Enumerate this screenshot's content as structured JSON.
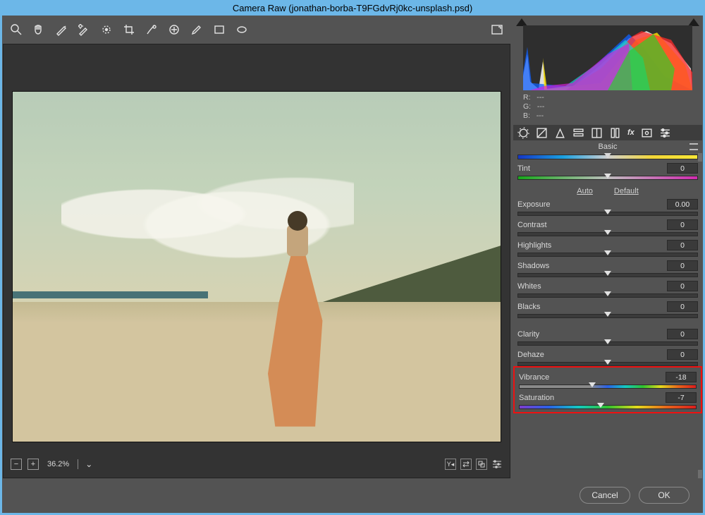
{
  "window": {
    "title": "Camera Raw (jonathan-borba-T9FGdvRj0kc-unsplash.psd)"
  },
  "toolbar": {
    "tools": [
      "zoom",
      "hand",
      "white-balance",
      "color-sampler",
      "target-adjust",
      "crop",
      "spot-heal",
      "red-eye",
      "brush",
      "rect",
      "oval"
    ]
  },
  "preview": {
    "zoom": "36.2%",
    "footer_icons": [
      "shrink",
      "grow"
    ]
  },
  "readout": {
    "R": {
      "label": "R:",
      "value": "---"
    },
    "G": {
      "label": "G:",
      "value": "---"
    },
    "B": {
      "label": "B:",
      "value": "---"
    }
  },
  "panel": {
    "heading": "Basic",
    "links": {
      "auto": "Auto",
      "default": "Default"
    },
    "sliders": {
      "tint": {
        "label": "Tint",
        "value": "0",
        "pos": 50,
        "grad": "gr-tint"
      },
      "exposure": {
        "label": "Exposure",
        "value": "0.00",
        "pos": 50
      },
      "contrast": {
        "label": "Contrast",
        "value": "0",
        "pos": 50
      },
      "highlights": {
        "label": "Highlights",
        "value": "0",
        "pos": 50
      },
      "shadows": {
        "label": "Shadows",
        "value": "0",
        "pos": 50
      },
      "whites": {
        "label": "Whites",
        "value": "0",
        "pos": 50
      },
      "blacks": {
        "label": "Blacks",
        "value": "0",
        "pos": 50
      },
      "clarity": {
        "label": "Clarity",
        "value": "0",
        "pos": 50
      },
      "dehaze": {
        "label": "Dehaze",
        "value": "0",
        "pos": 50
      },
      "vibrance": {
        "label": "Vibrance",
        "value": "-18",
        "pos": 41,
        "grad": "gr-vib"
      },
      "saturation": {
        "label": "Saturation",
        "value": "-7",
        "pos": 46,
        "grad": "gr-sat"
      }
    }
  },
  "buttons": {
    "cancel": "Cancel",
    "ok": "OK"
  }
}
